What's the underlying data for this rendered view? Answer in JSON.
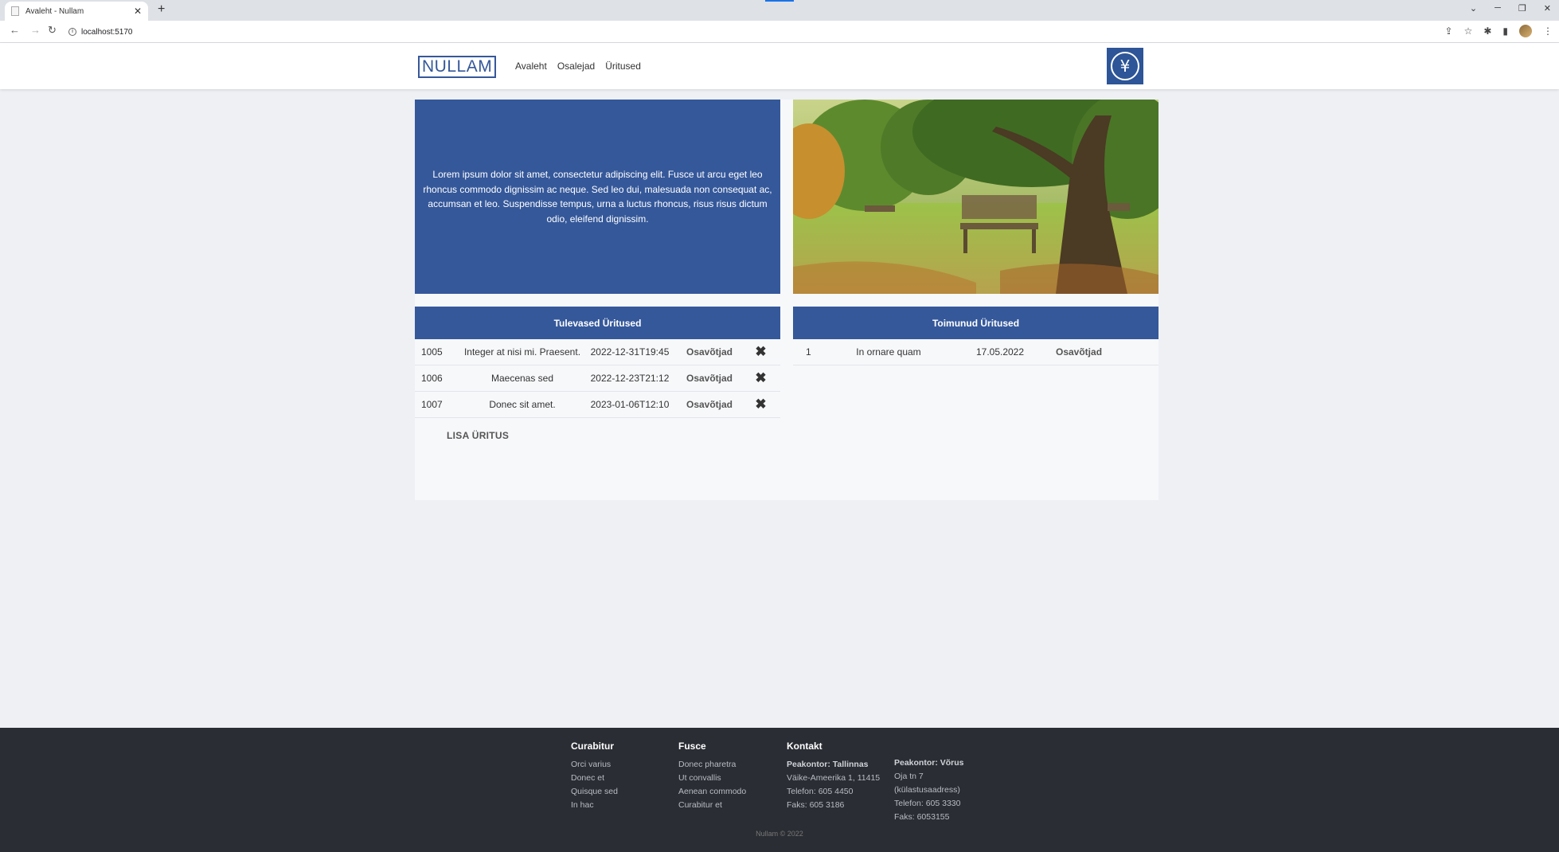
{
  "browser": {
    "tab_title": "Avaleht - Nullam",
    "url": "localhost:5170"
  },
  "header": {
    "logo": "NULLAM",
    "nav": [
      "Avaleht",
      "Osalejad",
      "Üritused"
    ]
  },
  "hero": {
    "text": "Lorem ipsum dolor sit amet, consectetur adipiscing elit. Fusce ut arcu eget leo rhoncus commodo dignissim ac neque. Sed leo dui, malesuada non consequat ac, accumsan et leo. Suspendisse tempus, urna a luctus rhoncus, risus risus dictum odio, eleifend dignissim."
  },
  "upcoming": {
    "title": "Tulevased Üritused",
    "rows": [
      {
        "id": "1005",
        "name": "Integer at nisi mi. Praesent.",
        "date": "2022-12-31T19:45",
        "link": "Osavõtjad"
      },
      {
        "id": "1006",
        "name": "Maecenas sed",
        "date": "2022-12-23T21:12",
        "link": "Osavõtjad"
      },
      {
        "id": "1007",
        "name": "Donec sit amet.",
        "date": "2023-01-06T12:10",
        "link": "Osavõtjad"
      }
    ],
    "add_label": "LISA ÜRITUS"
  },
  "past": {
    "title": "Toimunud Üritused",
    "rows": [
      {
        "id": "1",
        "name": "In ornare quam",
        "date": "17.05.2022",
        "link": "Osavõtjad"
      }
    ]
  },
  "footer": {
    "col1": {
      "title": "Curabitur",
      "items": [
        "Orci varius",
        "Donec et",
        "Quisque sed",
        "In hac"
      ]
    },
    "col2": {
      "title": "Fusce",
      "items": [
        "Donec pharetra",
        "Ut convallis",
        "Aenean commodo",
        "Curabitur et"
      ]
    },
    "col3": {
      "title": "Kontakt",
      "office": "Peakontor: Tallinnas",
      "lines": [
        "Väike-Ameerika 1, 11415",
        "Telefon: 605 4450",
        "Faks: 605 3186"
      ]
    },
    "col4": {
      "office": "Peakontor: Võrus",
      "lines": [
        "Oja tn 7",
        "(külastusaadress)",
        "Telefon: 605 3330",
        "Faks: 6053155"
      ]
    },
    "copyright": "Nullam © 2022"
  },
  "colors": {
    "brand": "#35589a",
    "footer_bg": "#2a2d33"
  }
}
